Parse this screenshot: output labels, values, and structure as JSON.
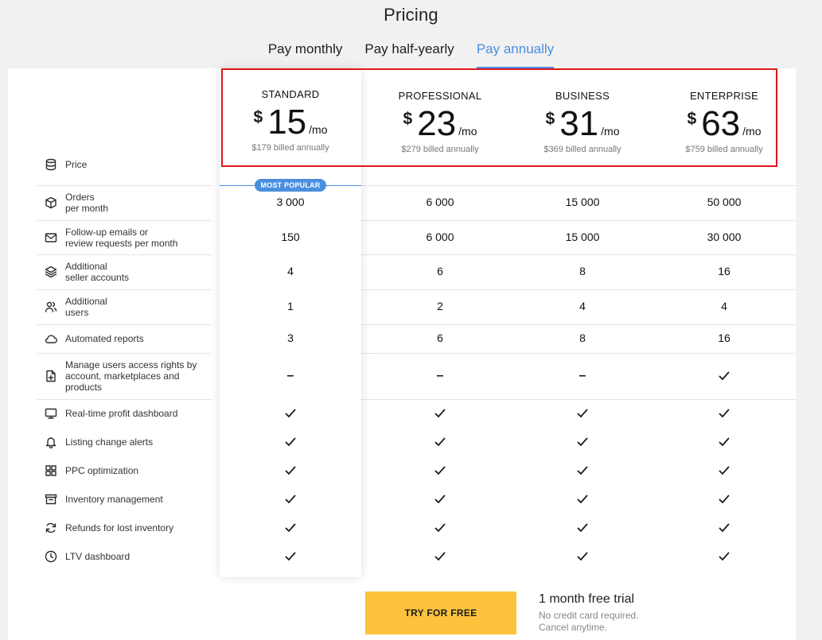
{
  "header": {
    "title": "Pricing",
    "tabs": [
      {
        "label": "Pay monthly",
        "active": false
      },
      {
        "label": "Pay half-yearly",
        "active": false
      },
      {
        "label": "Pay annually",
        "active": true
      }
    ]
  },
  "plans": [
    {
      "name": "STANDARD",
      "currency": "$",
      "price": "15",
      "per": "/mo",
      "billed": "$179 billed annually"
    },
    {
      "name": "PROFESSIONAL",
      "currency": "$",
      "price": "23",
      "per": "/mo",
      "billed": "$279 billed annually"
    },
    {
      "name": "BUSINESS",
      "currency": "$",
      "price": "31",
      "per": "/mo",
      "billed": "$369 billed annually"
    },
    {
      "name": "ENTERPRISE",
      "currency": "$",
      "price": "63",
      "per": "/mo",
      "billed": "$759 billed annually"
    }
  ],
  "badge": "MOST POPULAR",
  "price_label": "Price",
  "features": [
    {
      "label": "Orders\nper month",
      "icon": "box-icon",
      "values": [
        "3 000",
        "6 000",
        "15 000",
        "50 000"
      ]
    },
    {
      "label": "Follow-up emails or\nreview requests per month",
      "icon": "mail-icon",
      "values": [
        "150",
        "6 000",
        "15 000",
        "30 000"
      ]
    },
    {
      "label": "Additional\nseller accounts",
      "icon": "layers-icon",
      "values": [
        "4",
        "6",
        "8",
        "16"
      ]
    },
    {
      "label": "Additional\nusers",
      "icon": "users-icon",
      "values": [
        "1",
        "2",
        "4",
        "4"
      ]
    },
    {
      "label": "Automated reports",
      "icon": "cloud-icon",
      "values": [
        "3",
        "6",
        "8",
        "16"
      ]
    },
    {
      "label": "Manage users access rights by\naccount, marketplaces and\nproducts",
      "icon": "file-plus-icon",
      "values": [
        "–",
        "–",
        "–",
        "✓"
      ]
    },
    {
      "label": "Real-time profit dashboard",
      "icon": "monitor-icon",
      "values": [
        "✓",
        "✓",
        "✓",
        "✓"
      ]
    },
    {
      "label": "Listing change alerts",
      "icon": "bell-icon",
      "values": [
        "✓",
        "✓",
        "✓",
        "✓"
      ]
    },
    {
      "label": "PPC optimization",
      "icon": "grid-icon",
      "values": [
        "✓",
        "✓",
        "✓",
        "✓"
      ]
    },
    {
      "label": "Inventory management",
      "icon": "archive-icon",
      "values": [
        "✓",
        "✓",
        "✓",
        "✓"
      ]
    },
    {
      "label": "Refunds for lost inventory",
      "icon": "refresh-icon",
      "values": [
        "✓",
        "✓",
        "✓",
        "✓"
      ]
    },
    {
      "label": "LTV dashboard",
      "icon": "clock-icon",
      "values": [
        "✓",
        "✓",
        "✓",
        "✓"
      ]
    }
  ],
  "cta": {
    "button_label": "TRY FOR FREE",
    "trial_title": "1 month free trial",
    "trial_note_1": "No credit card required.",
    "trial_note_2": "Cancel anytime."
  },
  "colors": {
    "accent": "#4a8fe0",
    "cta": "#fdc33d",
    "highlight_border": "#e0161d"
  }
}
